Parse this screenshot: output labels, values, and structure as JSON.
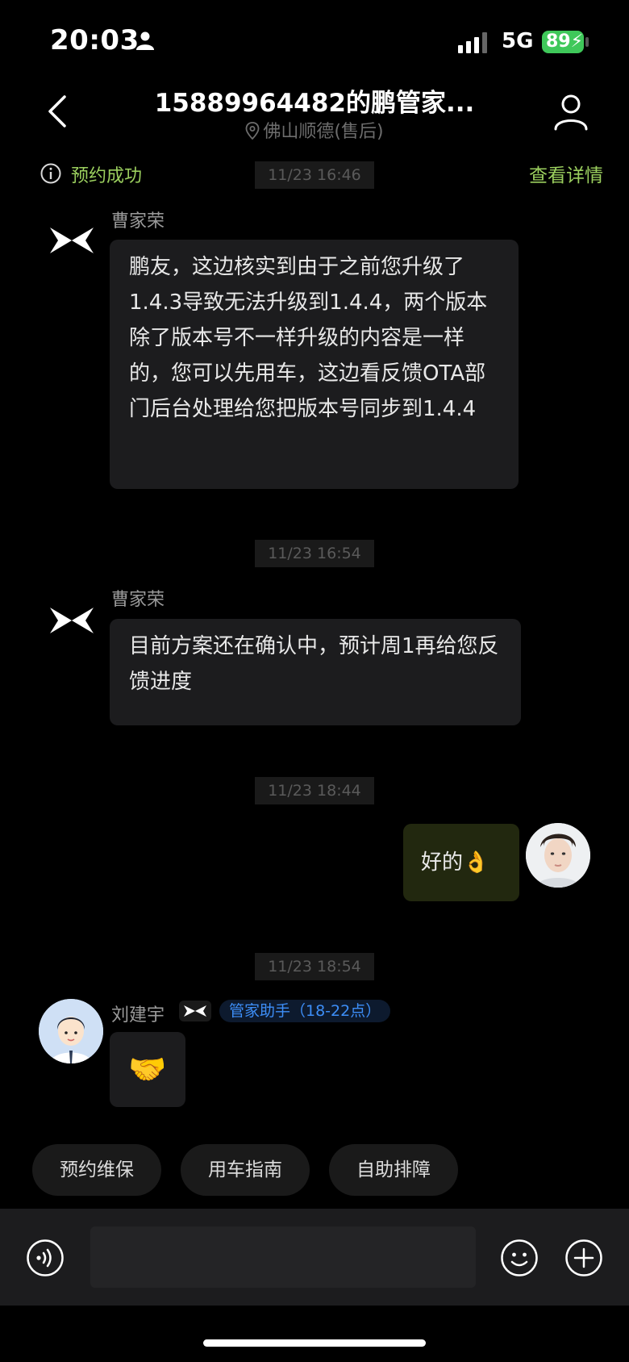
{
  "status_bar": {
    "time": "20:03",
    "network": "5G",
    "battery": "89"
  },
  "header": {
    "title": "15889964482的鹏管家...",
    "subtitle": "佛山顺德(售后)"
  },
  "banner": {
    "status": "预约成功",
    "details_link": "查看详情"
  },
  "messages": [
    {
      "time": "11/23 16:46",
      "sender": "曹家荣",
      "text": "鹏友，这边核实到由于之前您升级了 1.4.3导致无法升级到1.4.4，两个版本除了版本号不一样升级的内容是一样的，您可以先用车，这边看反馈OTA部门后台处理给您把版本号同步到1.4.4"
    },
    {
      "time": "11/23 16:54",
      "sender": "曹家荣",
      "text": "目前方案还在确认中，预计周1再给您反馈进度"
    },
    {
      "time": "11/23 18:44",
      "sender": "",
      "text": "好的👌"
    },
    {
      "time": "11/23 18:54",
      "sender": "刘建宇",
      "role": "管家助手（18-22点）",
      "text": "🤝"
    }
  ],
  "quick_actions": [
    "预约维保",
    "用车指南",
    "自助排障"
  ],
  "input": {
    "placeholder": ""
  },
  "colors": {
    "accent_green": "#9bcf5e",
    "role_blue": "#3d8ef7",
    "battery_green": "#3fc85a"
  }
}
